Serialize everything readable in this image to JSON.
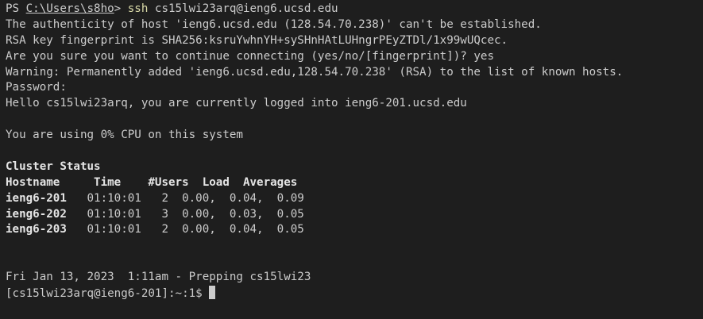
{
  "prompt": {
    "ps": "PS ",
    "path": "C:\\Users\\s8ho",
    "gt": "> ",
    "command": "ssh",
    "args": " cs15lwi23arq@ieng6.ucsd.edu"
  },
  "output": {
    "authenticity": "The authenticity of host 'ieng6.ucsd.edu (128.54.70.238)' can't be established.",
    "fingerprint": "RSA key fingerprint is SHA256:ksruYwhnYH+sySHnHAtLUHngrPEyZTDl/1x99wUQcec.",
    "confirm": "Are you sure you want to continue connecting (yes/no/[fingerprint])? yes",
    "warning": "Warning: Permanently added 'ieng6.ucsd.edu,128.54.70.238' (RSA) to the list of known hosts.",
    "password": "Password:",
    "hello": "Hello cs15lwi23arq, you are currently logged into ieng6-201.ucsd.edu",
    "cpu": "You are using 0% CPU on this system"
  },
  "cluster": {
    "title": "Cluster Status",
    "header": "Hostname     Time    #Users  Load  Averages",
    "rows": [
      {
        "host": "ieng6-201",
        "rest": "   01:10:01   2  0.00,  0.04,  0.09"
      },
      {
        "host": "ieng6-202",
        "rest": "   01:10:01   3  0.00,  0.03,  0.05"
      },
      {
        "host": "ieng6-203",
        "rest": "   01:10:01   2  0.00,  0.04,  0.05"
      }
    ]
  },
  "footer": {
    "date": "Fri Jan 13, 2023  1:11am - Prepping cs15lwi23",
    "remote_prompt": "[cs15lwi23arq@ieng6-201]:~:1$ "
  }
}
